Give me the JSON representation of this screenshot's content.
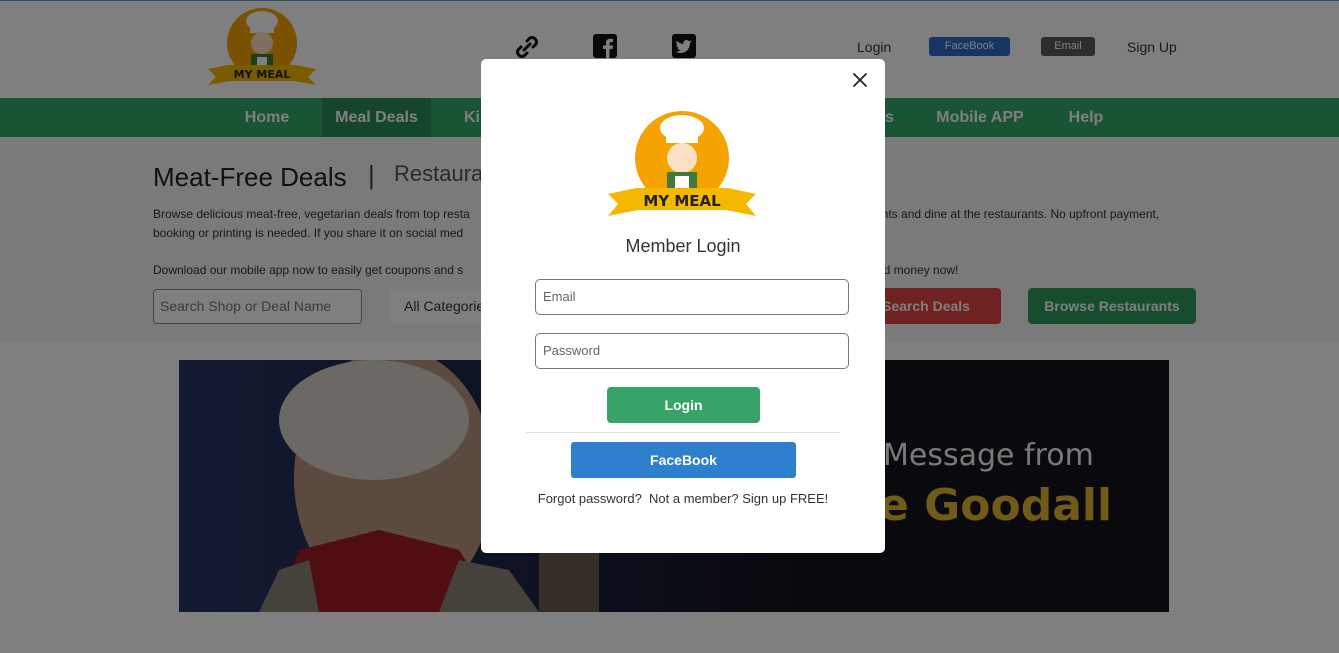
{
  "brand": {
    "name": "MY MEAL"
  },
  "header": {
    "login": "Login",
    "facebook": "FaceBook",
    "email": "Email",
    "signup": "Sign Up"
  },
  "nav": {
    "items": [
      {
        "label": "Home"
      },
      {
        "label": "Meal Deals"
      },
      {
        "label": "Ki"
      },
      {
        "label": "s"
      },
      {
        "label": "Mobile APP"
      },
      {
        "label": "Help"
      }
    ]
  },
  "main": {
    "title": "Meat-Free Deals",
    "separator": "|",
    "subtitle": "Restaurar",
    "desc_line1_left": "Browse delicious meat-free, vegetarian deals from top resta",
    "desc_line1_right": "unts and dine at the restaurants. No upfront payment,",
    "desc_line2_left": "booking or printing is needed. If you share it on social med",
    "desc_line3_left": "Download our mobile app now to easily get coupons and s",
    "desc_line3_right": "nd money now!",
    "search_placeholder": "Search Shop or Deal Name",
    "category": "All Categorie",
    "search_button": "Search Deals",
    "browse_button": "Browse Restaurants"
  },
  "banner": {
    "line1": "Message from",
    "line2": "e Goodall"
  },
  "modal": {
    "title": "Member Login",
    "email_placeholder": "Email",
    "password_placeholder": "Password",
    "login_button": "Login",
    "facebook_button": "FaceBook",
    "forgot": "Forgot password?",
    "signup": "Not a member? Sign up FREE!"
  },
  "colors": {
    "nav_green": "#32a96a",
    "login_green": "#38a367",
    "facebook_blue": "#2f7fcf",
    "search_red": "#e04545"
  }
}
